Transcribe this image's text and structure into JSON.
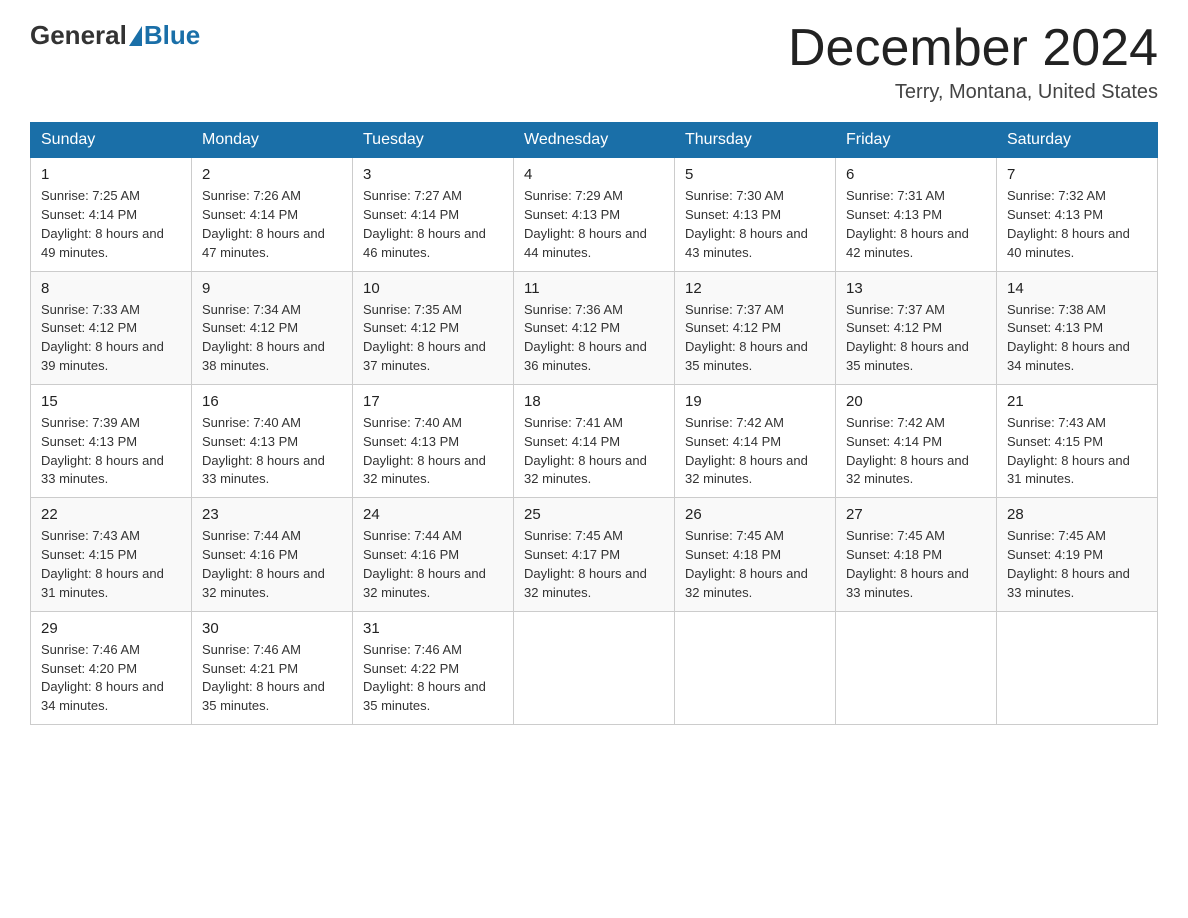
{
  "header": {
    "logo_general": "General",
    "logo_blue": "Blue",
    "month_title": "December 2024",
    "location": "Terry, Montana, United States"
  },
  "weekdays": [
    "Sunday",
    "Monday",
    "Tuesday",
    "Wednesday",
    "Thursday",
    "Friday",
    "Saturday"
  ],
  "weeks": [
    [
      {
        "day": "1",
        "sunrise": "7:25 AM",
        "sunset": "4:14 PM",
        "daylight": "8 hours and 49 minutes."
      },
      {
        "day": "2",
        "sunrise": "7:26 AM",
        "sunset": "4:14 PM",
        "daylight": "8 hours and 47 minutes."
      },
      {
        "day": "3",
        "sunrise": "7:27 AM",
        "sunset": "4:14 PM",
        "daylight": "8 hours and 46 minutes."
      },
      {
        "day": "4",
        "sunrise": "7:29 AM",
        "sunset": "4:13 PM",
        "daylight": "8 hours and 44 minutes."
      },
      {
        "day": "5",
        "sunrise": "7:30 AM",
        "sunset": "4:13 PM",
        "daylight": "8 hours and 43 minutes."
      },
      {
        "day": "6",
        "sunrise": "7:31 AM",
        "sunset": "4:13 PM",
        "daylight": "8 hours and 42 minutes."
      },
      {
        "day": "7",
        "sunrise": "7:32 AM",
        "sunset": "4:13 PM",
        "daylight": "8 hours and 40 minutes."
      }
    ],
    [
      {
        "day": "8",
        "sunrise": "7:33 AM",
        "sunset": "4:12 PM",
        "daylight": "8 hours and 39 minutes."
      },
      {
        "day": "9",
        "sunrise": "7:34 AM",
        "sunset": "4:12 PM",
        "daylight": "8 hours and 38 minutes."
      },
      {
        "day": "10",
        "sunrise": "7:35 AM",
        "sunset": "4:12 PM",
        "daylight": "8 hours and 37 minutes."
      },
      {
        "day": "11",
        "sunrise": "7:36 AM",
        "sunset": "4:12 PM",
        "daylight": "8 hours and 36 minutes."
      },
      {
        "day": "12",
        "sunrise": "7:37 AM",
        "sunset": "4:12 PM",
        "daylight": "8 hours and 35 minutes."
      },
      {
        "day": "13",
        "sunrise": "7:37 AM",
        "sunset": "4:12 PM",
        "daylight": "8 hours and 35 minutes."
      },
      {
        "day": "14",
        "sunrise": "7:38 AM",
        "sunset": "4:13 PM",
        "daylight": "8 hours and 34 minutes."
      }
    ],
    [
      {
        "day": "15",
        "sunrise": "7:39 AM",
        "sunset": "4:13 PM",
        "daylight": "8 hours and 33 minutes."
      },
      {
        "day": "16",
        "sunrise": "7:40 AM",
        "sunset": "4:13 PM",
        "daylight": "8 hours and 33 minutes."
      },
      {
        "day": "17",
        "sunrise": "7:40 AM",
        "sunset": "4:13 PM",
        "daylight": "8 hours and 32 minutes."
      },
      {
        "day": "18",
        "sunrise": "7:41 AM",
        "sunset": "4:14 PM",
        "daylight": "8 hours and 32 minutes."
      },
      {
        "day": "19",
        "sunrise": "7:42 AM",
        "sunset": "4:14 PM",
        "daylight": "8 hours and 32 minutes."
      },
      {
        "day": "20",
        "sunrise": "7:42 AM",
        "sunset": "4:14 PM",
        "daylight": "8 hours and 32 minutes."
      },
      {
        "day": "21",
        "sunrise": "7:43 AM",
        "sunset": "4:15 PM",
        "daylight": "8 hours and 31 minutes."
      }
    ],
    [
      {
        "day": "22",
        "sunrise": "7:43 AM",
        "sunset": "4:15 PM",
        "daylight": "8 hours and 31 minutes."
      },
      {
        "day": "23",
        "sunrise": "7:44 AM",
        "sunset": "4:16 PM",
        "daylight": "8 hours and 32 minutes."
      },
      {
        "day": "24",
        "sunrise": "7:44 AM",
        "sunset": "4:16 PM",
        "daylight": "8 hours and 32 minutes."
      },
      {
        "day": "25",
        "sunrise": "7:45 AM",
        "sunset": "4:17 PM",
        "daylight": "8 hours and 32 minutes."
      },
      {
        "day": "26",
        "sunrise": "7:45 AM",
        "sunset": "4:18 PM",
        "daylight": "8 hours and 32 minutes."
      },
      {
        "day": "27",
        "sunrise": "7:45 AM",
        "sunset": "4:18 PM",
        "daylight": "8 hours and 33 minutes."
      },
      {
        "day": "28",
        "sunrise": "7:45 AM",
        "sunset": "4:19 PM",
        "daylight": "8 hours and 33 minutes."
      }
    ],
    [
      {
        "day": "29",
        "sunrise": "7:46 AM",
        "sunset": "4:20 PM",
        "daylight": "8 hours and 34 minutes."
      },
      {
        "day": "30",
        "sunrise": "7:46 AM",
        "sunset": "4:21 PM",
        "daylight": "8 hours and 35 minutes."
      },
      {
        "day": "31",
        "sunrise": "7:46 AM",
        "sunset": "4:22 PM",
        "daylight": "8 hours and 35 minutes."
      },
      null,
      null,
      null,
      null
    ]
  ]
}
